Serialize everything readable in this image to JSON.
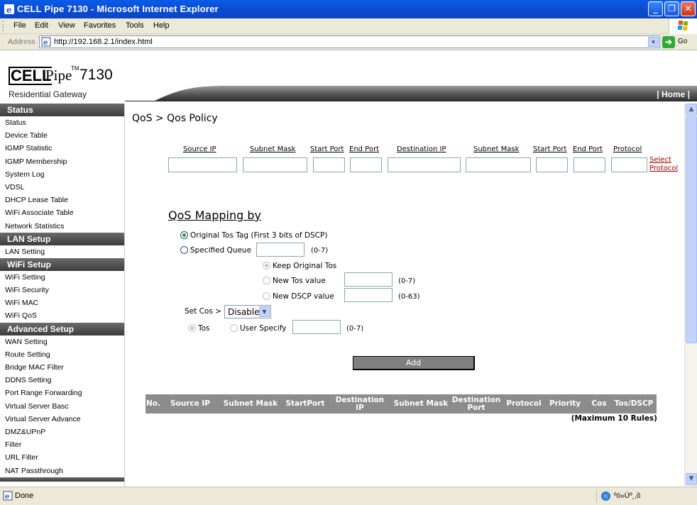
{
  "window": {
    "title": "CELL Pipe 7130 - Microsoft Internet Explorer",
    "minimize": "_",
    "maximize": "❐",
    "close": "✕"
  },
  "menu": [
    "File",
    "Edit",
    "View",
    "Favorites",
    "Tools",
    "Help"
  ],
  "address": {
    "label": "Address",
    "url": "http://192.168.2.1/index.html",
    "go": "Go"
  },
  "logo": {
    "brand1": "CELL",
    "brand2": "Pipe",
    "tm": "TM",
    "model": "7130",
    "subtitle": "Residential Gateway"
  },
  "header": {
    "home": "| Home |"
  },
  "sidebar": {
    "status": {
      "title": "Status",
      "items": [
        "Status",
        "Device Table",
        "IGMP Statistic",
        "IGMP Membership",
        "System Log",
        "VDSL",
        "DHCP Lease Table",
        "WiFi Associate Table",
        "Network Statistics"
      ]
    },
    "lan": {
      "title": "LAN Setup",
      "items": [
        "LAN Setting"
      ]
    },
    "wifi": {
      "title": "WiFi Setup",
      "items": [
        "WiFi Setting",
        "WiFi Security",
        "WiFi MAC",
        "WiFi QoS"
      ]
    },
    "advanced": {
      "title": "Advanced Setup",
      "items": [
        "WAN Setting",
        "Route Setting",
        "Bridge MAC Filter",
        "DDNS Setting",
        "Port Range Forwarding",
        "Virtual Server Basc",
        "Virtual Server Advance",
        "DMZ&UPnP",
        "Filter",
        "URL Filter",
        "NAT Passthrough"
      ]
    }
  },
  "page": {
    "title": "QoS > Qos Policy"
  },
  "policy": {
    "columns": [
      "Source IP",
      "Subnet Mask",
      "Start Port",
      "End Port",
      "Destination IP",
      "Subnet Mask",
      "Start Port",
      "End Port",
      "Protocol"
    ],
    "select_protocol_1": "Select",
    "select_protocol_2": "Protocol"
  },
  "mapping": {
    "title": "QoS Mapping by",
    "original_tos": "Original Tos Tag (First 3 bits of DSCP)",
    "specified_queue": "Specified Queue",
    "queue_range": "(0-7)",
    "keep_original": "Keep Original Tos",
    "new_tos": "New Tos value",
    "new_tos_range": "(0-7)",
    "new_dscp": "New DSCP value",
    "new_dscp_range": "(0-63)",
    "set_cos": "Set Cos >",
    "cos_value": "Disable",
    "tos": "Tos",
    "user_specify": "User Specify",
    "user_range": "(0-7)"
  },
  "add_button": "Add",
  "rules": {
    "headers": [
      "No.",
      "Source IP",
      "Subnet Mask",
      "StartPort",
      "Destination IP",
      "Subnet Mask",
      "Destination Port",
      "Protocol",
      "Priority",
      "Cos",
      "Tos/DSCP"
    ],
    "max_note": "(Maximum 10 Rules)"
  },
  "statusbar": {
    "text": "Done",
    "zone": "ºó»Ùº¸,ô"
  }
}
